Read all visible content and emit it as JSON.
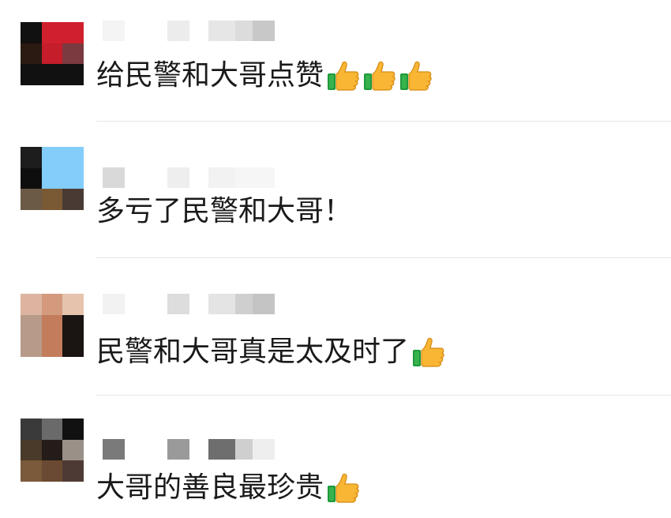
{
  "comments": [
    {
      "text": "给民警和大哥点赞",
      "reaction_icon": "thumbs-up-icon",
      "reaction_count": 3,
      "avatar": [
        "#111111",
        "#d0202e",
        "#d0202e",
        "#2a1a12",
        "#c51d2a",
        "#7a3a40",
        "#111111",
        "#111111",
        "#111111"
      ],
      "name_blocks": [
        "#f4f4f4",
        "#ececec",
        "#e6e6e6",
        "#dcdcdc",
        "#c8c8c8"
      ]
    },
    {
      "text": "多亏了民警和大哥！",
      "reaction_icon": "",
      "reaction_count": 0,
      "avatar": [
        "#1d1d1d",
        "#83cdfa",
        "#83cdfa",
        "#0e0e0e",
        "#83cdfa",
        "#83cdfa",
        "#6b5a45",
        "#7a5a35",
        "#4a3a34"
      ],
      "name_blocks": [
        "#d9d9d9",
        "#eeeeee",
        "#f2f2f2",
        "#f6f6f6",
        "#f6f6f6"
      ]
    },
    {
      "text": "民警和大哥真是太及时了",
      "reaction_icon": "thumbs-up-icon",
      "reaction_count": 1,
      "avatar": [
        "#dcb4a0",
        "#d49a7e",
        "#e6c3ad",
        "#b89a88",
        "#c37c5c",
        "#1a1412",
        "#b89a88",
        "#c37c5c",
        "#1a1412"
      ],
      "name_blocks": [
        "#f2f2f2",
        "#dddddd",
        "#e4e4e4",
        "#cfcfcf",
        "#c4c4c4"
      ]
    },
    {
      "text": "大哥的善良最珍贵",
      "reaction_icon": "thumbs-up-icon",
      "reaction_count": 1,
      "avatar": [
        "#3a3a3a",
        "#6a6a6a",
        "#111111",
        "#4a3a2a",
        "#231c18",
        "#9a9088",
        "#7a5a3a",
        "#6a4a32",
        "#4e3a34"
      ],
      "name_blocks": [
        "#7a7a7a",
        "#9a9a9a",
        "#6e6e6e",
        "#cfcfcf",
        "#eeeeee"
      ]
    }
  ]
}
